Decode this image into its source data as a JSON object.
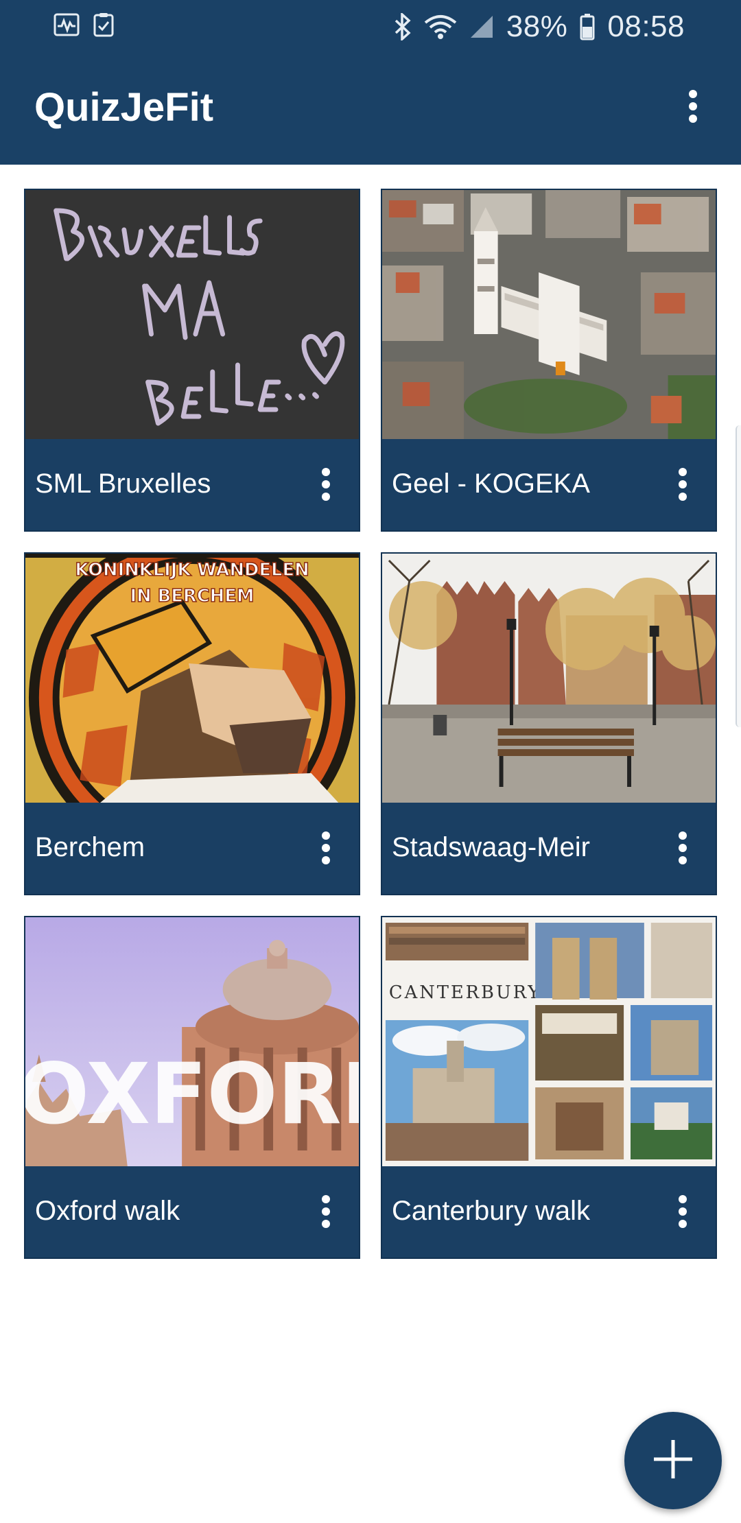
{
  "status_bar": {
    "left_icons": [
      "activity-monitor-icon",
      "clipboard-check-icon"
    ],
    "right_icons": [
      "bluetooth-icon",
      "wifi-icon",
      "signal-icon",
      "battery-icon"
    ],
    "battery_percent": "38%",
    "time": "08:58"
  },
  "app_bar": {
    "title": "QuizJeFit",
    "overflow_icon": "more-vert-icon"
  },
  "cards": [
    {
      "title": "SML Bruxelles",
      "image": "chalkboard-bruxelles-image"
    },
    {
      "title": "Geel - KOGEKA",
      "image": "aerial-geel-church-image"
    },
    {
      "title": "Berchem",
      "image": "stained-glass-berchem-image",
      "image_caption_line1": "KONINKLIJK WANDELEN",
      "image_caption_line2": "IN BERCHEM"
    },
    {
      "title": "Stadswaag-Meir",
      "image": "square-bench-image"
    },
    {
      "title": "Oxford walk",
      "image": "oxford-radcliffe-image",
      "image_caption": "OXFORD"
    },
    {
      "title": "Canterbury walk",
      "image": "canterbury-postcard-image",
      "image_caption": "CANTERBURY"
    }
  ],
  "fab": {
    "icon": "add-icon"
  },
  "colors": {
    "primary": "#1a4166",
    "card": "#1a3f63",
    "background": "#ffffff"
  }
}
